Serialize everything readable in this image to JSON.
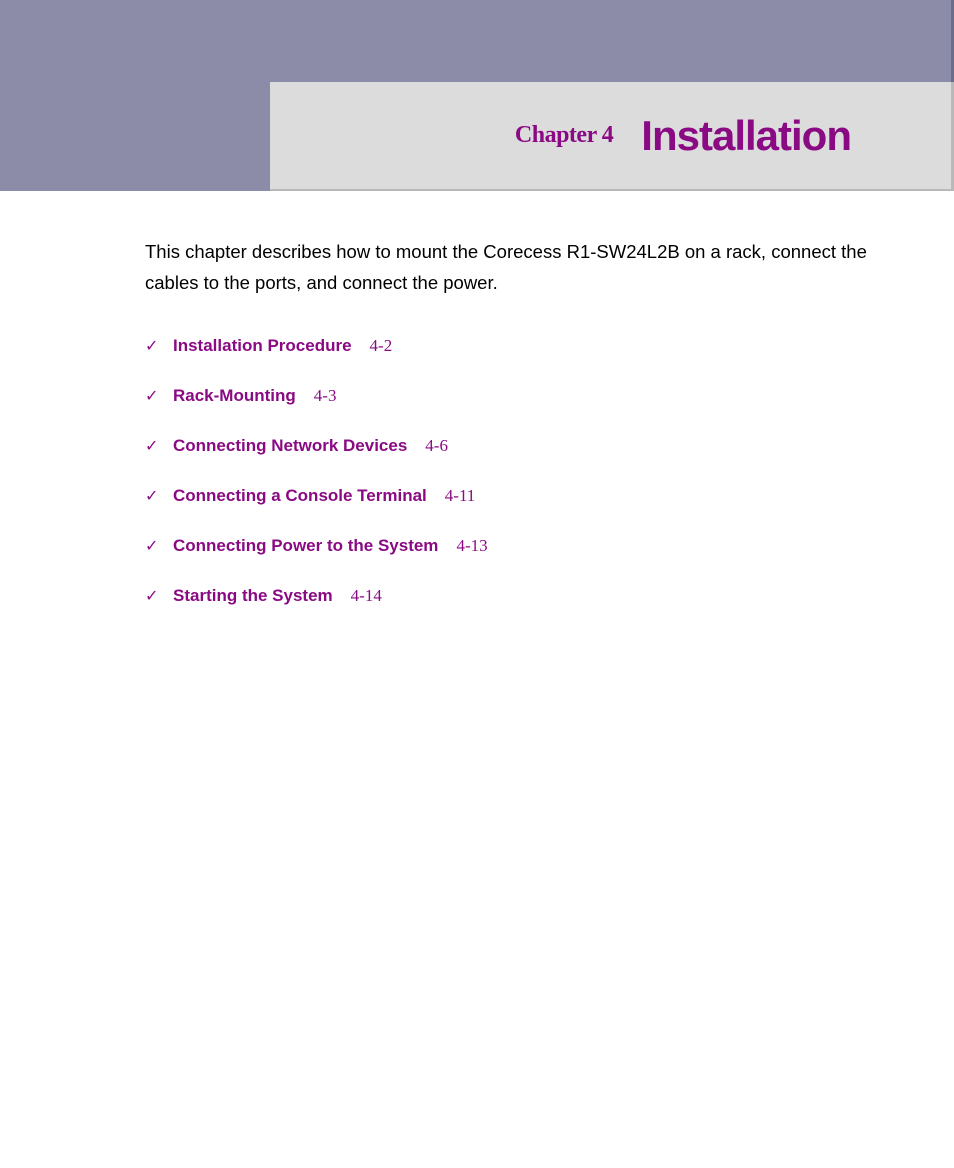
{
  "header": {
    "chapter_label": "Chapter 4",
    "chapter_title": "Installation"
  },
  "intro": "This chapter describes how to mount the Corecess R1-SW24L2B on a rack, connect the cables to the ports, and connect the power.",
  "toc": [
    {
      "label": "Installation Procedure",
      "page": "4-2"
    },
    {
      "label": "Rack-Mounting",
      "page": "4-3"
    },
    {
      "label": "Connecting Network Devices",
      "page": "4-6"
    },
    {
      "label": "Connecting a Console Terminal",
      "page": "4-11"
    },
    {
      "label": "Connecting Power to the System",
      "page": "4-13"
    },
    {
      "label": "Starting the System",
      "page": "4-14"
    }
  ]
}
